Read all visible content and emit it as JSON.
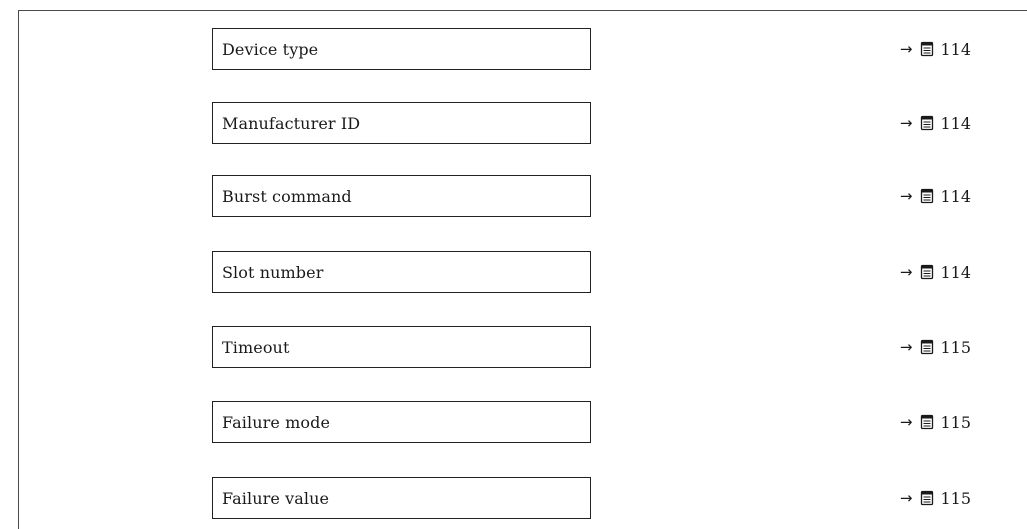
{
  "rows": [
    {
      "label": "Device type",
      "arrow": "→",
      "page": "114"
    },
    {
      "label": "Manufacturer ID",
      "arrow": "→",
      "page": "114"
    },
    {
      "label": "Burst command",
      "arrow": "→",
      "page": "114"
    },
    {
      "label": "Slot number",
      "arrow": "→",
      "page": "114"
    },
    {
      "label": "Timeout",
      "arrow": "→",
      "page": "115"
    },
    {
      "label": "Failure mode",
      "arrow": "→",
      "page": "115"
    },
    {
      "label": "Failure value",
      "arrow": "→",
      "page": "115"
    }
  ],
  "icons": {
    "page_reference": "book-page-icon",
    "arrow": "right-arrow-icon"
  }
}
